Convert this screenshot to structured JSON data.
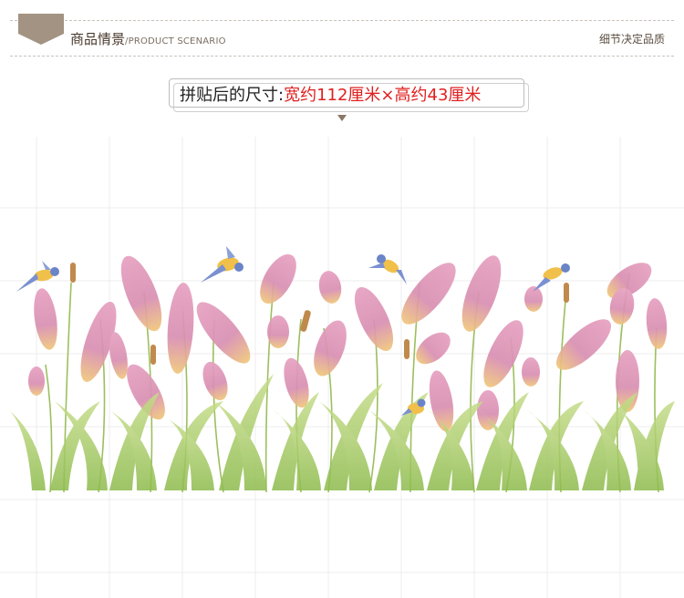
{
  "header": {
    "title_cn": "商品情景",
    "title_en": "/PRODUCT SCENARIO",
    "detail_label": "细节决定品质"
  },
  "size_label": {
    "prefix": "拼贴后的尺寸:",
    "value": "宽约112厘米×高约43厘米"
  },
  "scene": {
    "description_icon": "reed-grass-birds-wall-decal",
    "colors": {
      "plume_pink": "#d98fb2",
      "plume_yellow": "#f0c77a",
      "grass_green": "#9cc35a",
      "grid_line": "#eeeeee",
      "header_tag": "#a39382"
    }
  }
}
